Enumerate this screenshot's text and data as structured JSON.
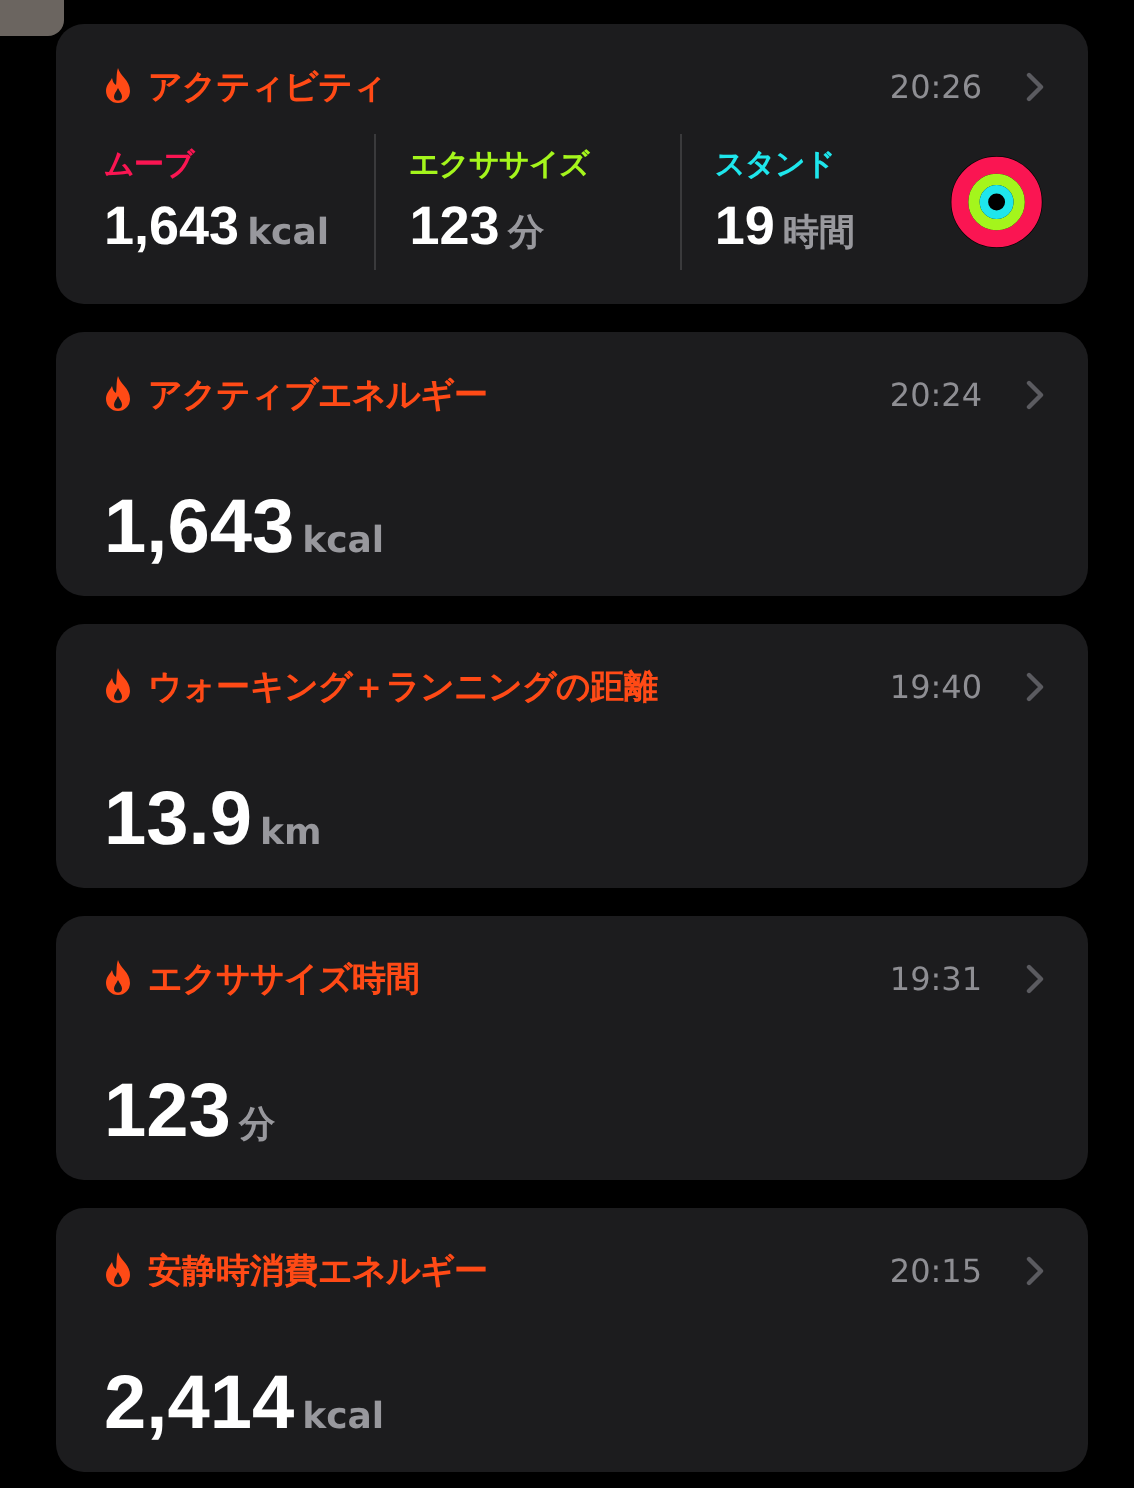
{
  "activity_summary": {
    "title": "アクティビティ",
    "time": "20:26",
    "metrics": [
      {
        "label": "ムーブ",
        "value": "1,643",
        "unit": "kcal",
        "color": "#fa1552"
      },
      {
        "label": "エクササイズ",
        "value": "123",
        "unit": "分",
        "color": "#a4f51c"
      },
      {
        "label": "スタンド",
        "value": "19",
        "unit": "時間",
        "color": "#1ee6ec"
      }
    ]
  },
  "cards": [
    {
      "title": "アクティブエネルギー",
      "time": "20:24",
      "value": "1,643",
      "unit": "kcal"
    },
    {
      "title": "ウォーキング＋ランニングの距離",
      "time": "19:40",
      "value": "13.9",
      "unit": "km"
    },
    {
      "title": "エクササイズ時間",
      "time": "19:31",
      "value": "123",
      "unit": "分"
    },
    {
      "title": "安静時消費エネルギー",
      "time": "20:15",
      "value": "2,414",
      "unit": "kcal"
    }
  ]
}
